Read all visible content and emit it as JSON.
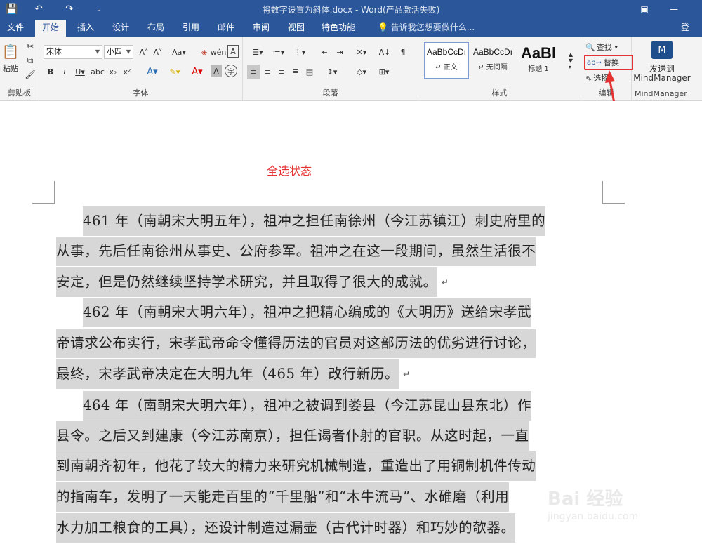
{
  "window": {
    "title": "将数字设置为斜体.docx - Word(产品激活失败)"
  },
  "quick_access": {
    "save": "💾",
    "undo": "↶",
    "redo": "↷",
    "more": "⌄"
  },
  "tabs": [
    {
      "label": "文件"
    },
    {
      "label": "开始"
    },
    {
      "label": "插入"
    },
    {
      "label": "设计"
    },
    {
      "label": "布局"
    },
    {
      "label": "引用"
    },
    {
      "label": "邮件"
    },
    {
      "label": "审阅"
    },
    {
      "label": "视图"
    },
    {
      "label": "特色功能"
    }
  ],
  "tell_me": "告诉我您想要做什么...",
  "login": "登录",
  "clipboard": {
    "paste": "粘贴",
    "label": "剪贴板"
  },
  "font": {
    "name": "宋体",
    "size": "小四",
    "label": "字体"
  },
  "paragraph": {
    "label": "段落"
  },
  "styles": {
    "items": [
      {
        "preview": "AaBbCcDı",
        "name": "↵ 正文"
      },
      {
        "preview": "AaBbCcDı",
        "name": "↵ 无间隔"
      },
      {
        "preview": "AaBl",
        "name": "标题 1"
      }
    ],
    "label": "样式"
  },
  "editing": {
    "find": "查找",
    "replace": "替换",
    "select": "选择",
    "label": "编辑"
  },
  "mindmanager": {
    "send": "发送到",
    "name1": "MindManager",
    "label": "MindManager"
  },
  "annotation": "全选状态",
  "document": {
    "lines": [
      "461 年（南朝宋大明五年），祖冲之担任南徐州（今江苏镇江）刺史府里的",
      "从事，先后任南徐州从事史、公府参军。祖冲之在这一段期间，虽然生活很不",
      "安定，但是仍然继续坚持学术研究，并且取得了很大的成就。",
      "462 年（南朝宋大明六年），祖冲之把精心编成的《大明历》送给宋孝武",
      "帝请求公布实行，宋孝武帝命令懂得历法的官员对这部历法的优劣进行讨论，",
      "最终，宋孝武帝决定在大明九年（465 年）改行新历。",
      "464 年（南朝宋大明六年），祖冲之被调到娄县（今江苏昆山县东北）作",
      "县令。之后又到建康（今江苏南京），担任谒者仆射的官职。从这时起，一直",
      "到南朝齐初年，他花了较大的精力来研究机械制造，重造出了用铜制机件传动",
      "的指南车，发明了一天能走百里的“千里船”和“木牛流马”、水碓磨（利用",
      "水力加工粮食的工具），还设计制造过漏壶（古代计时器）和巧妙的欹器。"
    ],
    "para_mark": "↵"
  },
  "watermark": {
    "text": "Bai 经验",
    "sub": "jingyan.baidu.com"
  },
  "colors": {
    "accent": "#2b579a",
    "highlight": "#d7d7d7",
    "annotation": "#e53333"
  }
}
